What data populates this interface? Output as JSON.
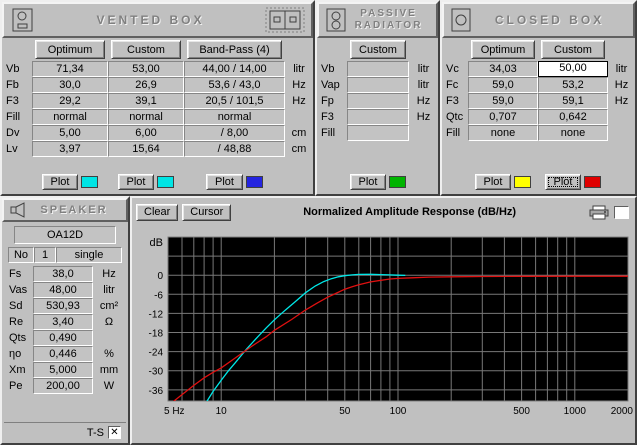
{
  "labels": {
    "plot": "Plot"
  },
  "panels": {
    "vented": {
      "title": "VENTED BOX",
      "columns": [
        "Optimum",
        "Custom",
        "Band-Pass (4)"
      ],
      "rows": [
        {
          "label": "Vb",
          "values": [
            "71,34",
            "53,00",
            "44,00 / 14,00"
          ],
          "unit": "litr"
        },
        {
          "label": "Fb",
          "values": [
            "30,0",
            "26,9",
            "53,6 / 43,0"
          ],
          "unit": "Hz"
        },
        {
          "label": "F3",
          "values": [
            "29,2",
            "39,1",
            "20,5 / 101,5"
          ],
          "unit": "Hz"
        },
        {
          "label": "Fill",
          "values": [
            "normal",
            "normal",
            "normal"
          ],
          "unit": ""
        },
        {
          "label": "Dv",
          "values": [
            "5,00",
            "6,00",
            "/ 8,00"
          ],
          "unit": "cm"
        },
        {
          "label": "Lv",
          "values": [
            "3,97",
            "15,64",
            "/ 48,88"
          ],
          "unit": "cm"
        }
      ],
      "plot_colors": [
        "#00e5e5",
        "#00e5e5",
        "#2424e0"
      ]
    },
    "passive": {
      "title_line1": "PASSIVE",
      "title_line2": "RADIATOR",
      "columns": [
        "Custom"
      ],
      "rows": [
        {
          "label": "Vb",
          "value": "",
          "unit": "litr"
        },
        {
          "label": "Vap",
          "value": "",
          "unit": "litr"
        },
        {
          "label": "Fp",
          "value": "",
          "unit": "Hz"
        },
        {
          "label": "F3",
          "value": "",
          "unit": "Hz"
        },
        {
          "label": "Fill",
          "value": "",
          "unit": ""
        }
      ],
      "plot_color": "#00b400"
    },
    "closed": {
      "title": "CLOSED BOX",
      "columns": [
        "Optimum",
        "Custom"
      ],
      "rows": [
        {
          "label": "Vc",
          "values": [
            "34,03",
            "50,00"
          ],
          "unit": "litr"
        },
        {
          "label": "Fc",
          "values": [
            "59,0",
            "53,2"
          ],
          "unit": "Hz"
        },
        {
          "label": "F3",
          "values": [
            "59,0",
            "59,1"
          ],
          "unit": "Hz"
        },
        {
          "label": "Qtc",
          "values": [
            "0,707",
            "0,642"
          ],
          "unit": ""
        },
        {
          "label": "Fill",
          "values": [
            "none",
            "none"
          ],
          "unit": ""
        }
      ],
      "highlight": {
        "row": 0,
        "col": 1
      },
      "plot_colors": [
        "#ffff00",
        "#e00000"
      ]
    },
    "speaker": {
      "title": "SPEAKER",
      "model": "OA12D",
      "no_label": "No",
      "no_value": "1",
      "wiring": "single",
      "rows": [
        {
          "label": "Fs",
          "value": "38,0",
          "unit": "Hz"
        },
        {
          "label": "Vas",
          "value": "48,00",
          "unit": "litr"
        },
        {
          "label": "Sd",
          "value": "530,93",
          "unit": "cm²"
        },
        {
          "label": "Re",
          "value": "3,40",
          "unit": "Ω"
        },
        {
          "label": "Qts",
          "value": "0,490",
          "unit": ""
        },
        {
          "label": "ηo",
          "value": "0,446",
          "unit": "%"
        },
        {
          "label": "Xm",
          "value": "5,000",
          "unit": "mm"
        },
        {
          "label": "Pe",
          "value": "200,00",
          "unit": "W"
        }
      ],
      "ts_label": "T-S"
    }
  },
  "chart": {
    "clear_label": "Clear",
    "cursor_label": "Cursor",
    "title": "Normalized Amplitude Response (dB/Hz)"
  },
  "chart_data": {
    "type": "line",
    "title": "Normalized Amplitude Response (dB/Hz)",
    "x_scale": "log",
    "xlabel": "",
    "ylabel": "dB",
    "xlim": [
      5,
      2000
    ],
    "ylim": [
      -39.5,
      12
    ],
    "grid": true,
    "legend": "none",
    "y_ticks": [
      0,
      -6,
      -12,
      -18,
      -24,
      -30,
      -36
    ],
    "x_ticks": [
      {
        "f": 5,
        "label": "5 Hz"
      },
      {
        "f": 10,
        "label": "10"
      },
      {
        "f": 50,
        "label": "50"
      },
      {
        "f": 100,
        "label": "100"
      },
      {
        "f": 500,
        "label": "500"
      },
      {
        "f": 1000,
        "label": "1000"
      },
      {
        "f": 2000,
        "label": "2000"
      }
    ],
    "grid_x": [
      5,
      6,
      7,
      8,
      9,
      10,
      20,
      30,
      40,
      50,
      60,
      70,
      80,
      90,
      100,
      200,
      300,
      400,
      500,
      600,
      700,
      800,
      900,
      1000,
      2000
    ],
    "grid_y": [
      6,
      0,
      -6,
      -12,
      -18,
      -24,
      -30,
      -36
    ],
    "series": [
      {
        "name": "vented-box-optimum",
        "color": "#00e8e8",
        "points": [
          [
            8,
            -41
          ],
          [
            9,
            -36.5
          ],
          [
            10,
            -33
          ],
          [
            11,
            -30
          ],
          [
            12,
            -27.5
          ],
          [
            14,
            -23
          ],
          [
            16,
            -19.5
          ],
          [
            18,
            -16.5
          ],
          [
            20,
            -14
          ],
          [
            23,
            -11
          ],
          [
            26,
            -8.5
          ],
          [
            30,
            -5.5
          ],
          [
            34,
            -3.4
          ],
          [
            38,
            -2
          ],
          [
            42,
            -1.1
          ],
          [
            46,
            -0.5
          ],
          [
            50,
            -0.15
          ],
          [
            55,
            0.1
          ],
          [
            60,
            0.25
          ],
          [
            70,
            0.3
          ],
          [
            80,
            0.2
          ],
          [
            90,
            0.1
          ],
          [
            100,
            0
          ],
          [
            110,
            -0.05
          ]
        ]
      },
      {
        "name": "closed-box-custom",
        "color": "#e01010",
        "points": [
          [
            5,
            -41
          ],
          [
            6,
            -37.5
          ],
          [
            7,
            -34.6
          ],
          [
            8,
            -32.2
          ],
          [
            9,
            -30.5
          ],
          [
            10,
            -29.1
          ],
          [
            12,
            -26
          ],
          [
            15,
            -22.2
          ],
          [
            18,
            -19.3
          ],
          [
            20,
            -17.3
          ],
          [
            25,
            -13.9
          ],
          [
            30,
            -10.9
          ],
          [
            35,
            -8.7
          ],
          [
            40,
            -6.9
          ],
          [
            45,
            -5.6
          ],
          [
            50,
            -4.4
          ],
          [
            55,
            -3.6
          ],
          [
            60,
            -3.0
          ],
          [
            70,
            -2.1
          ],
          [
            80,
            -1.6
          ],
          [
            90,
            -1.2
          ],
          [
            100,
            -1.0
          ],
          [
            120,
            -0.8
          ],
          [
            150,
            -0.6
          ],
          [
            200,
            -0.5
          ],
          [
            300,
            -0.4
          ],
          [
            500,
            -0.35
          ],
          [
            1000,
            -0.3
          ],
          [
            2000,
            -0.3
          ]
        ]
      }
    ]
  }
}
